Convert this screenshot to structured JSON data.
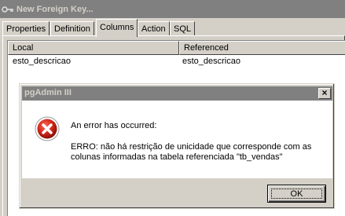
{
  "background_window": {
    "title": "New Foreign Key...",
    "tabs": [
      {
        "label": "Properties"
      },
      {
        "label": "Definition"
      },
      {
        "label": "Columns",
        "active": true
      },
      {
        "label": "Action"
      },
      {
        "label": "SQL"
      }
    ],
    "columns_list": {
      "headers": [
        "Local",
        "Referenced"
      ],
      "rows": [
        [
          "esto_descricao",
          "esto_descricao"
        ]
      ]
    }
  },
  "dialog": {
    "title": "pgAdmin III",
    "icon": "error-icon",
    "message_heading": "An error has occurred:",
    "message_line1": "ERRO:  não há restrição de unicidade que corresponde com as",
    "message_line2": "colunas informadas na tabela referenciada \"tb_vendas\"",
    "ok_label": "OK",
    "close_glyph": "×"
  },
  "colors": {
    "window_face": "#d4d0c8",
    "inactive_titlebar": "#808080",
    "error_red": "#cc2222"
  }
}
